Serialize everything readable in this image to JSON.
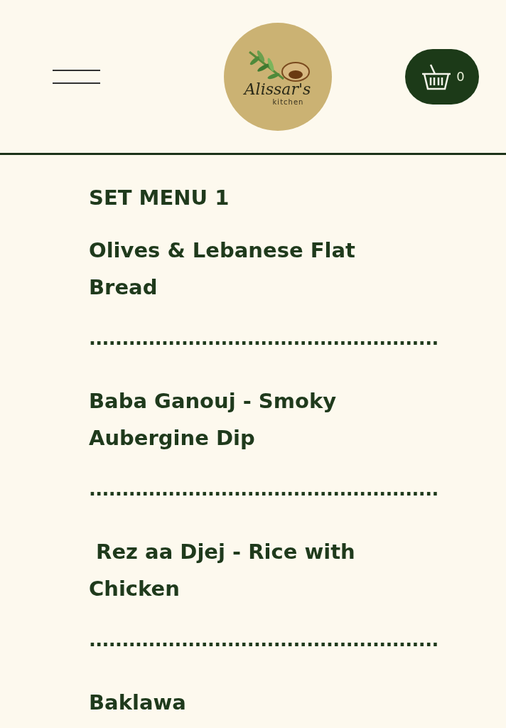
{
  "header": {
    "logo": {
      "title": "Alissar's",
      "subtitle": "kitchen"
    },
    "cart": {
      "count": "0"
    }
  },
  "menu": {
    "title": "SET MENU 1",
    "entries": [
      {
        "kind": "dish",
        "text": "Olives & Lebanese Flat Bread"
      },
      {
        "kind": "separator",
        "text": "....................................................."
      },
      {
        "kind": "dish",
        "text": "Baba Ganouj - Smoky Aubergine Dip"
      },
      {
        "kind": "separator",
        "text": "....................................................."
      },
      {
        "kind": "dish",
        "text": " Rez aa Djej - Rice with Chicken"
      },
      {
        "kind": "separator",
        "text": "....................................................."
      },
      {
        "kind": "dish",
        "text": "Baklawa"
      }
    ]
  }
}
